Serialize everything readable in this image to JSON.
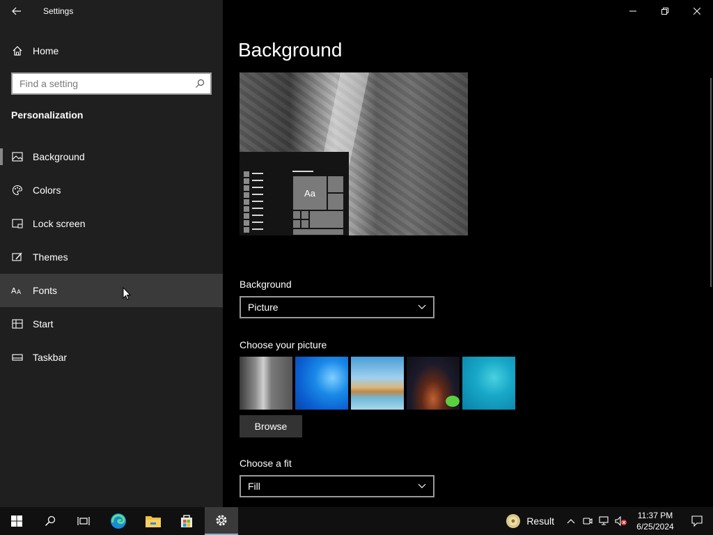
{
  "window": {
    "title": "Settings",
    "minimize_icon": "minimize-icon",
    "maximize_icon": "restore-icon",
    "close_icon": "close-icon"
  },
  "sidebar": {
    "home_label": "Home",
    "search_placeholder": "Find a setting",
    "section_title": "Personalization",
    "items": [
      {
        "label": "Background",
        "icon": "picture-icon",
        "selected": true
      },
      {
        "label": "Colors",
        "icon": "palette-icon"
      },
      {
        "label": "Lock screen",
        "icon": "lock-screen-icon"
      },
      {
        "label": "Themes",
        "icon": "themes-icon"
      },
      {
        "label": "Fonts",
        "icon": "fonts-icon",
        "hover": true
      },
      {
        "label": "Start",
        "icon": "start-icon"
      },
      {
        "label": "Taskbar",
        "icon": "taskbar-icon"
      }
    ]
  },
  "main": {
    "title": "Background",
    "preview_tile_text": "Aa",
    "background_label": "Background",
    "background_value": "Picture",
    "choose_picture_label": "Choose your picture",
    "browse_label": "Browse",
    "choose_fit_label": "Choose a fit",
    "fit_value": "Fill"
  },
  "taskbar": {
    "weather_text": "Result",
    "time": "11:37 PM",
    "date": "6/25/2024"
  },
  "colors": {
    "sidebar_bg": "#1f1f1f",
    "main_bg": "#000000",
    "taskbar_bg": "#101010",
    "hover_bg": "#3a3a3a"
  }
}
